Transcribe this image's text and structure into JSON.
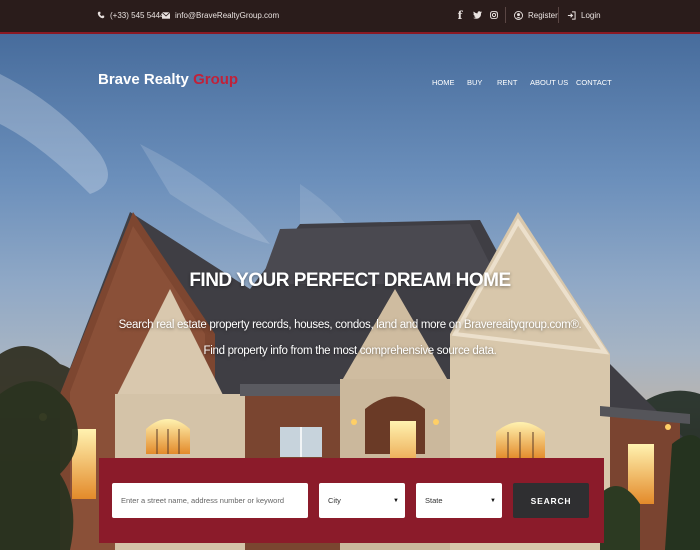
{
  "topbar": {
    "phone": "(+33) 545 5444",
    "email": "info@BraveRealtyGroup.com",
    "register_label": "Register",
    "login_label": "Login"
  },
  "header": {
    "brand_primary": "Brave Realty",
    "brand_accent": "Group",
    "nav": [
      "HOME",
      "BUY",
      "RENT",
      "ABOUT US",
      "CONTACT"
    ]
  },
  "hero": {
    "headline": "FIND YOUR PERFECT DREAM HOME",
    "subline1": "Search real estate property records, houses, condos, land and more on Bravereaityqroup.com®.",
    "subline2": "Find property info from the most comprehensive source data."
  },
  "search": {
    "placeholder": "Enter a street name, address number or keyword",
    "city_label": "City",
    "state_label": "State",
    "button_label": "SEARCH"
  },
  "colors": {
    "accent": "#8b1b2a",
    "brand_accent": "#c0223a",
    "topbar_bg": "#2a1c1b",
    "button_bg": "#2f2f31"
  }
}
